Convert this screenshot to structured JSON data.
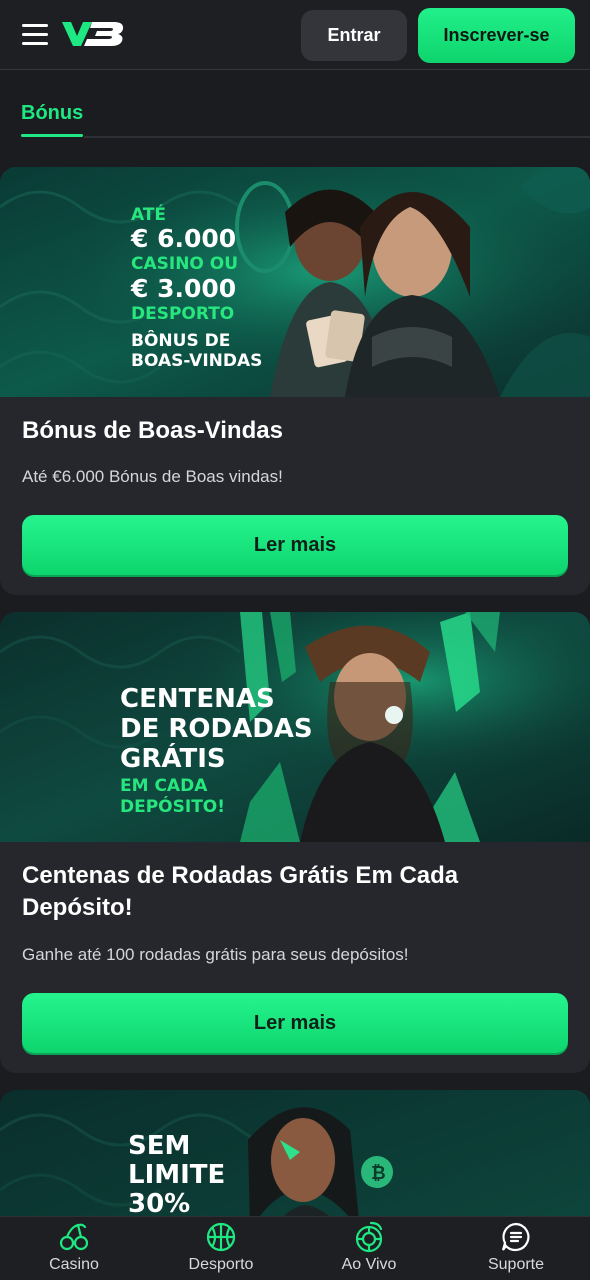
{
  "header": {
    "login_label": "Entrar",
    "signup_label": "Inscrever-se",
    "brand_color": "#1de882"
  },
  "tabs": {
    "active_label": "Bónus"
  },
  "promos": [
    {
      "banner_lines": [
        "ATÉ",
        "€ 6.000",
        "CASINO OU",
        "€ 3.000",
        "DESPORTO",
        "BÔNUS DE",
        "BOAS-VINDAS"
      ],
      "title": "Bónus de Boas-Vindas",
      "description": "Até €6.000 Bónus de Boas vindas!",
      "button_label": "Ler mais"
    },
    {
      "banner_lines": [
        "CENTENAS",
        "DE RODADAS",
        "GRÁTIS",
        "EM CADA",
        "DEPÓSITO!"
      ],
      "title": "Centenas de Rodadas Grátis Em Cada Depósito!",
      "description": "Ganhe até 100 rodadas grátis para seus depósitos!",
      "button_label": "Ler mais"
    },
    {
      "banner_lines": [
        "SEM",
        "LIMITE",
        "30%"
      ]
    }
  ],
  "bottom_nav": [
    {
      "label": "Casino",
      "icon": "cherries-icon"
    },
    {
      "label": "Desporto",
      "icon": "basketball-icon"
    },
    {
      "label": "Ao Vivo",
      "icon": "roulette-icon"
    },
    {
      "label": "Suporte",
      "icon": "chat-icon"
    }
  ]
}
